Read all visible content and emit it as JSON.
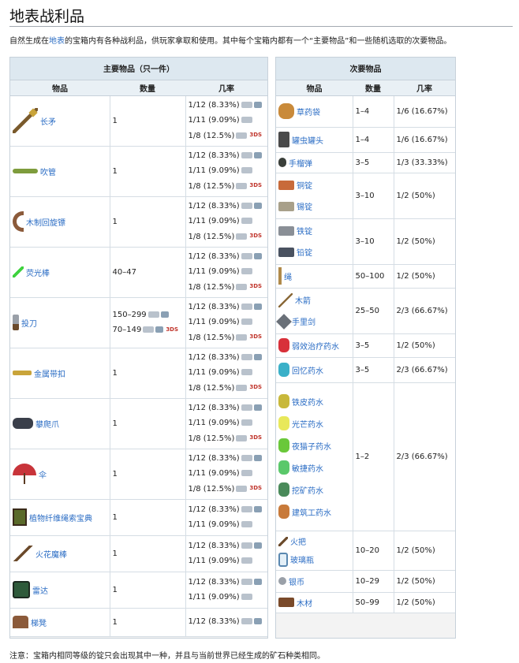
{
  "page": {
    "title": "地表战利品",
    "intro_pre": "自然生成在",
    "intro_link": "地表",
    "intro_post": "的宝箱内有各种战利品，供玩家拿取和使用。其中每个宝箱内都有一个“主要物品”和一些随机选取的次要物品。",
    "note": "注意：宝箱内相同等级的锭只会出现其中一种，并且与当前世界已经生成的矿石种类相同。"
  },
  "main_table": {
    "caption": "主要物品（只一件）",
    "col_item": "物品",
    "col_qty": "数量",
    "col_rate": "几率",
    "rows": [
      {
        "name": "长矛",
        "icon": "spear-icon",
        "qty": "1",
        "rates": [
          "1/12 (8.33%)",
          "1/11 (9.09%)",
          "1/8 (12.5%)"
        ]
      },
      {
        "name": "吹管",
        "icon": "blowpipe-icon",
        "qty": "1",
        "rates": [
          "1/12 (8.33%)",
          "1/11 (9.09%)",
          "1/8 (12.5%)"
        ]
      },
      {
        "name": "木制回旋镖",
        "icon": "boomerang-icon",
        "qty": "1",
        "rates": [
          "1/12 (8.33%)",
          "1/11 (9.09%)",
          "1/8 (12.5%)"
        ]
      },
      {
        "name": "荧光棒",
        "icon": "glowstick-icon",
        "qty": "40–47",
        "rates": [
          "1/12 (8.33%)",
          "1/11 (9.09%)",
          "1/8 (12.5%)"
        ]
      },
      {
        "name": "投刀",
        "icon": "throwing-knife-icon",
        "qty": "150–299",
        "qty2": "70–149",
        "rates": [
          "1/12 (8.33%)",
          "1/11 (9.09%)",
          "1/8 (12.5%)"
        ]
      },
      {
        "name": "金属带扣",
        "icon": "metal-buckle-icon",
        "qty": "1",
        "rates": [
          "1/12 (8.33%)",
          "1/11 (9.09%)",
          "1/8 (12.5%)"
        ]
      },
      {
        "name": "攀爬爪",
        "icon": "climbing-claws-icon",
        "qty": "1",
        "rates": [
          "1/12 (8.33%)",
          "1/11 (9.09%)",
          "1/8 (12.5%)"
        ]
      },
      {
        "name": "伞",
        "icon": "umbrella-icon",
        "qty": "1",
        "rates": [
          "1/12 (8.33%)",
          "1/11 (9.09%)",
          "1/8 (12.5%)"
        ]
      },
      {
        "name": "植物纤维绳索宝典",
        "icon": "book-icon",
        "qty": "1",
        "rates": [
          "1/12 (8.33%)",
          "1/11 (9.09%)"
        ]
      },
      {
        "name": "火花魔棒",
        "icon": "wand-icon",
        "qty": "1",
        "rates": [
          "1/12 (8.33%)",
          "1/11 (9.09%)"
        ]
      },
      {
        "name": "雷达",
        "icon": "radar-icon",
        "qty": "1",
        "rates": [
          "1/12 (8.33%)",
          "1/11 (9.09%)"
        ]
      },
      {
        "name": "梯凳",
        "icon": "stool-icon",
        "qty": "1",
        "rates": [
          "1/12 (8.33%)"
        ]
      }
    ]
  },
  "sec_table": {
    "caption": "次要物品",
    "col_item": "物品",
    "col_qty": "数量",
    "col_rate": "几率",
    "rows": [
      {
        "items": [
          {
            "name": "草药袋",
            "icon": "herb-bag-icon"
          }
        ],
        "qty": "1–4",
        "rate": "1/6 (16.67%)"
      },
      {
        "items": [
          {
            "name": "罐虫罐头",
            "icon": "grub-jar-icon"
          }
        ],
        "qty": "1–4",
        "rate": "1/6 (16.67%)"
      },
      {
        "items": [
          {
            "name": "手榴弹",
            "icon": "grenade-icon"
          }
        ],
        "qty": "3–5",
        "rate": "1/3 (33.33%)"
      },
      {
        "items": [
          {
            "name": "铜锭",
            "icon": "copper-bar-icon"
          },
          {
            "name": "锡锭",
            "icon": "tin-bar-icon"
          }
        ],
        "qty": "3–10",
        "rate": "1/2 (50%)"
      },
      {
        "items": [
          {
            "name": "铁锭",
            "icon": "iron-bar-icon"
          },
          {
            "name": "铅锭",
            "icon": "lead-bar-icon"
          }
        ],
        "qty": "3–10",
        "rate": "1/2 (50%)"
      },
      {
        "items": [
          {
            "name": "绳",
            "icon": "rope-icon"
          }
        ],
        "qty": "50–100",
        "rate": "1/2 (50%)"
      },
      {
        "items": [
          {
            "name": "木箭",
            "icon": "wooden-arrow-icon"
          },
          {
            "name": "手里剑",
            "icon": "shuriken-icon"
          }
        ],
        "qty": "25–50",
        "rate": "2/3 (66.67%)"
      },
      {
        "items": [
          {
            "name": "弱效治疗药水",
            "icon": "healing-potion-icon"
          }
        ],
        "qty": "3–5",
        "rate": "1/2 (50%)"
      },
      {
        "items": [
          {
            "name": "回忆药水",
            "icon": "recall-potion-icon"
          }
        ],
        "qty": "3–5",
        "rate": "2/3 (66.67%)"
      },
      {
        "items": [
          {
            "name": "铁皮药水",
            "icon": "ironskin-potion-icon"
          },
          {
            "name": "光芒药水",
            "icon": "shine-potion-icon"
          },
          {
            "name": "夜猫子药水",
            "icon": "night-owl-potion-icon"
          },
          {
            "name": "敏捷药水",
            "icon": "swiftness-potion-icon"
          },
          {
            "name": "挖矿药水",
            "icon": "mining-potion-icon"
          },
          {
            "name": "建筑工药水",
            "icon": "builder-potion-icon"
          }
        ],
        "qty": "1–2",
        "rate": "2/3 (66.67%)"
      },
      {
        "items": [
          {
            "name": "火把",
            "icon": "torch-icon"
          },
          {
            "name": "玻璃瓶",
            "icon": "bottle-icon"
          }
        ],
        "qty": "10–20",
        "rate": "1/2 (50%)"
      },
      {
        "items": [
          {
            "name": "银币",
            "icon": "silver-coin-icon"
          }
        ],
        "qty": "10–29",
        "rate": "1/2 (50%)"
      },
      {
        "items": [
          {
            "name": "木材",
            "icon": "wood-icon"
          }
        ],
        "qty": "50–99",
        "rate": "1/2 (50%)"
      }
    ]
  },
  "platforms": {
    "three_ds": "3DS"
  }
}
